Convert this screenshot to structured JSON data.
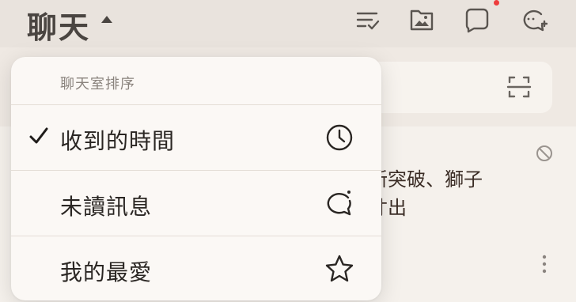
{
  "header": {
    "title": "聊天",
    "icons": [
      "chevron-up-icon",
      "sort-list-icon",
      "image-album-icon",
      "square-chat-icon",
      "new-chat-icon"
    ],
    "badge_color": "#ee3d3d"
  },
  "background": {
    "search_icon": "scan-icon",
    "preview_line1": "新突破、獅子",
    "preview_line2": "寸出",
    "icons": [
      "mute-icon",
      "more-vertical-icon"
    ]
  },
  "sort_menu": {
    "header": "聊天室排序",
    "items": [
      {
        "label": "收到的時間",
        "icon": "clock-icon",
        "checked": true
      },
      {
        "label": "未讀訊息",
        "icon": "chat-bubble-icon",
        "checked": false
      },
      {
        "label": "我的最愛",
        "icon": "star-icon",
        "checked": false
      }
    ]
  }
}
